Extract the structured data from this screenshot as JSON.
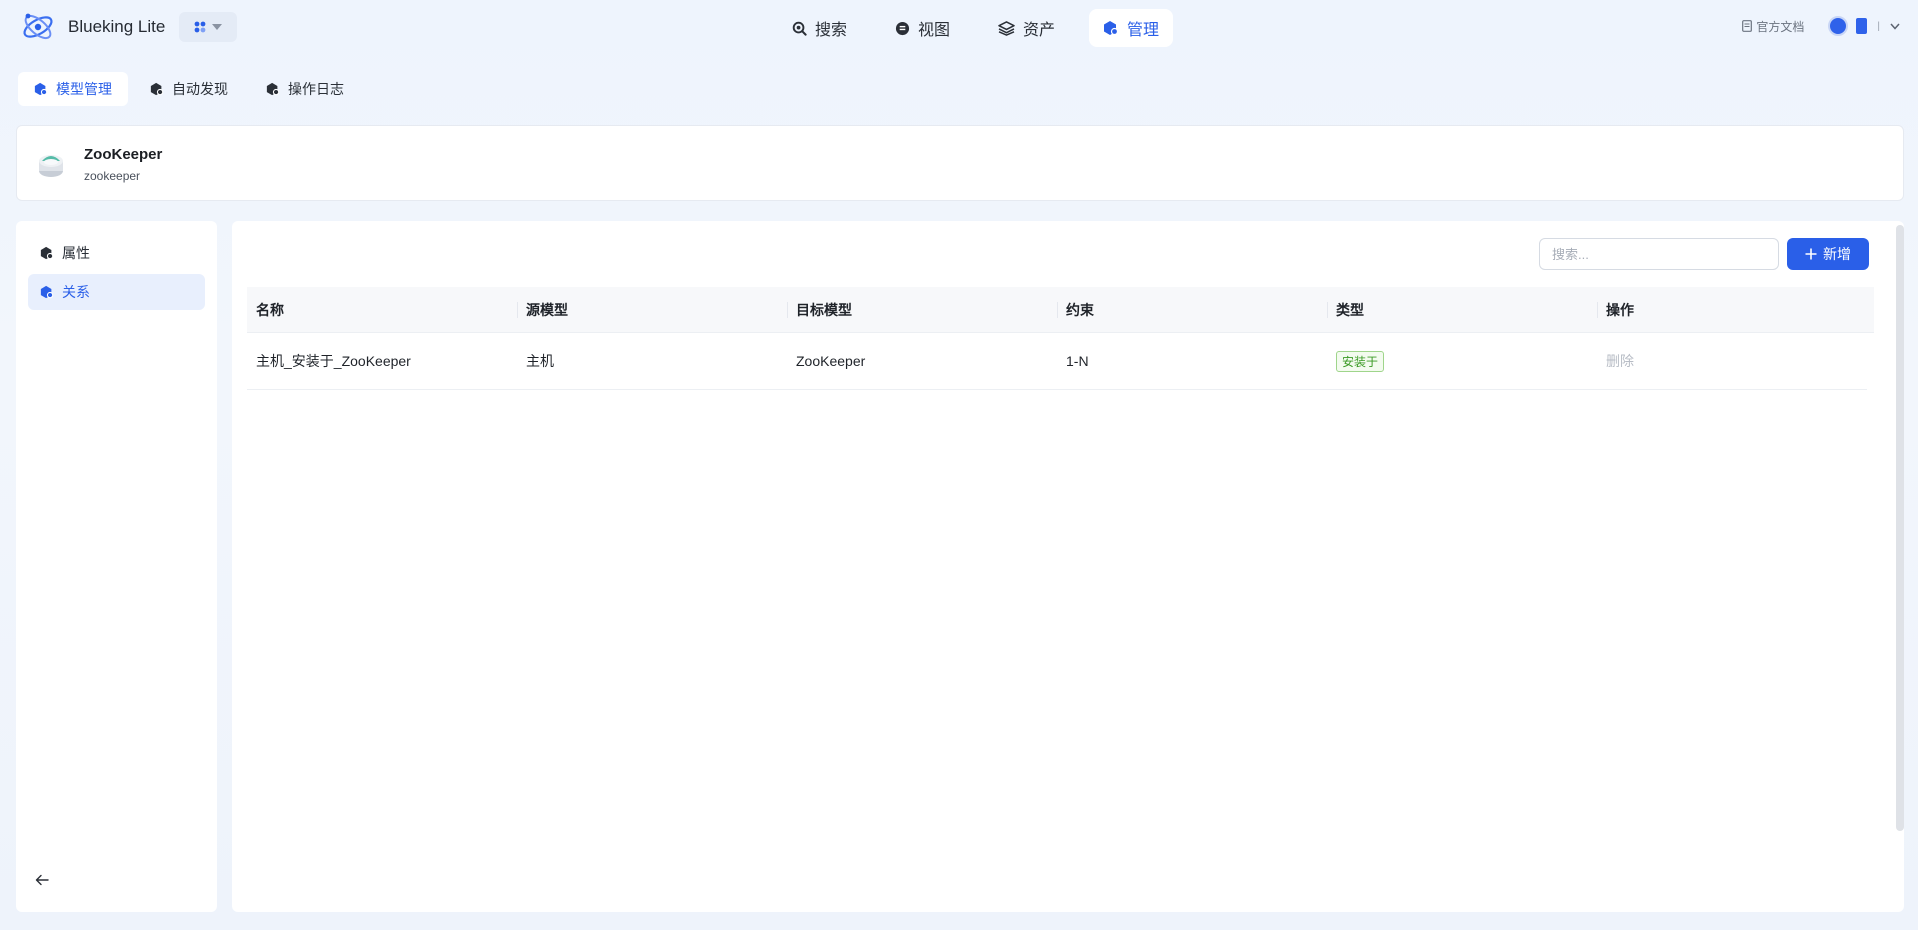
{
  "header": {
    "brand": "Blueking Lite",
    "nav": [
      {
        "label": "搜索",
        "icon": "search-icon",
        "active": false
      },
      {
        "label": "视图",
        "icon": "view-icon",
        "active": false
      },
      {
        "label": "资产",
        "icon": "layers-icon",
        "active": false
      },
      {
        "label": "管理",
        "icon": "manage-icon",
        "active": true
      }
    ],
    "doc_link": "官方文档",
    "user_sep": "|"
  },
  "subtabs": [
    {
      "label": "模型管理",
      "active": true
    },
    {
      "label": "自动发现",
      "active": false
    },
    {
      "label": "操作日志",
      "active": false
    }
  ],
  "model": {
    "name": "ZooKeeper",
    "id": "zookeeper"
  },
  "sidebar": {
    "items": [
      {
        "label": "属性",
        "active": false
      },
      {
        "label": "关系",
        "active": true
      }
    ]
  },
  "toolbar": {
    "search_placeholder": "搜索...",
    "add_label": "新增"
  },
  "table": {
    "columns": [
      "名称",
      "源模型",
      "目标模型",
      "约束",
      "类型",
      "操作"
    ],
    "rows": [
      {
        "name": "主机_安装于_ZooKeeper",
        "source": "主机",
        "target": "ZooKeeper",
        "constraint": "1-N",
        "type": "安装于",
        "action": "删除"
      }
    ]
  },
  "colors": {
    "accent": "#2a5fe8",
    "tag_green": "#3a9a24"
  }
}
